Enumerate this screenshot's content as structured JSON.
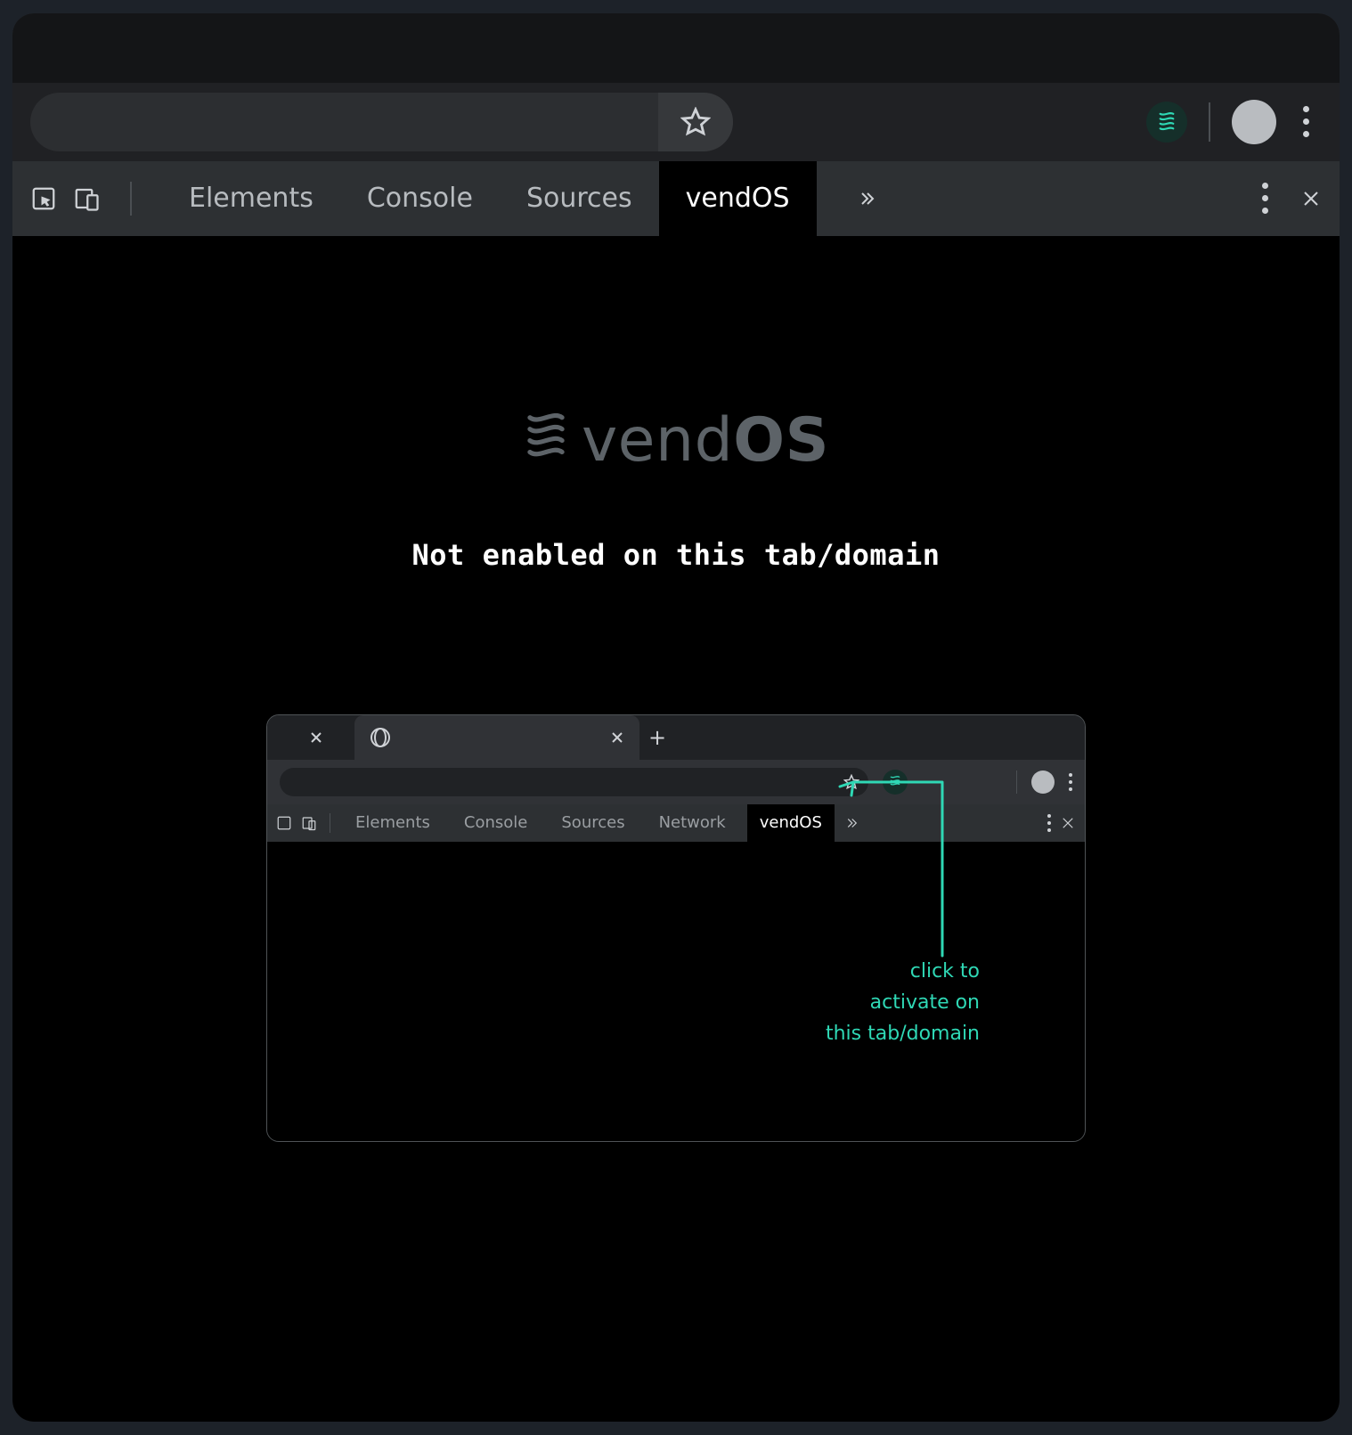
{
  "browser": {
    "extension_name": "vendOS",
    "star_title": "Bookmark"
  },
  "devtools": {
    "tabs": {
      "elements": "Elements",
      "console": "Console",
      "sources": "Sources",
      "vendos": "vendOS"
    }
  },
  "panel": {
    "brand_prefix": "vend",
    "brand_suffix": "OS",
    "message": "Not enabled on this tab/domain"
  },
  "mini": {
    "tabs": {
      "elements": "Elements",
      "console": "Console",
      "sources": "Sources",
      "network": "Network",
      "vendos": "vendOS"
    },
    "hint_line1": "click to",
    "hint_line2": "activate on",
    "hint_line3": "this tab/domain"
  },
  "colors": {
    "accent": "#2fd8b5"
  }
}
